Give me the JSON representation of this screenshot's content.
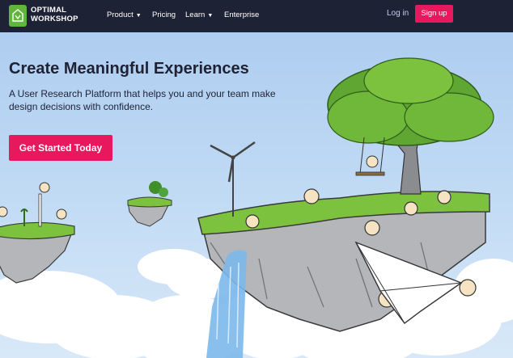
{
  "brand": {
    "line1": "OPTIMAL",
    "line2": "WORKSHOP"
  },
  "nav": {
    "items": [
      {
        "label": "Product",
        "has_dropdown": true
      },
      {
        "label": "Pricing",
        "has_dropdown": false
      },
      {
        "label": "Learn",
        "has_dropdown": true
      },
      {
        "label": "Enterprise",
        "has_dropdown": false
      }
    ],
    "login_label": "Log in",
    "signup_label": "Sign up"
  },
  "hero": {
    "headline": "Create Meaningful Experiences",
    "subtitle": "A User Research Platform that helps you and your team make design decisions with confidence.",
    "cta_label": "Get Started Today"
  },
  "colors": {
    "nav_bg": "#1e2235",
    "accent": "#e8185f",
    "brand_green": "#62b53b",
    "sky": "#bcd8f2",
    "grass": "#7dc23f"
  },
  "icons": {
    "chevron": "chevron-down-icon",
    "logo": "optimal-workshop-logo-icon"
  }
}
